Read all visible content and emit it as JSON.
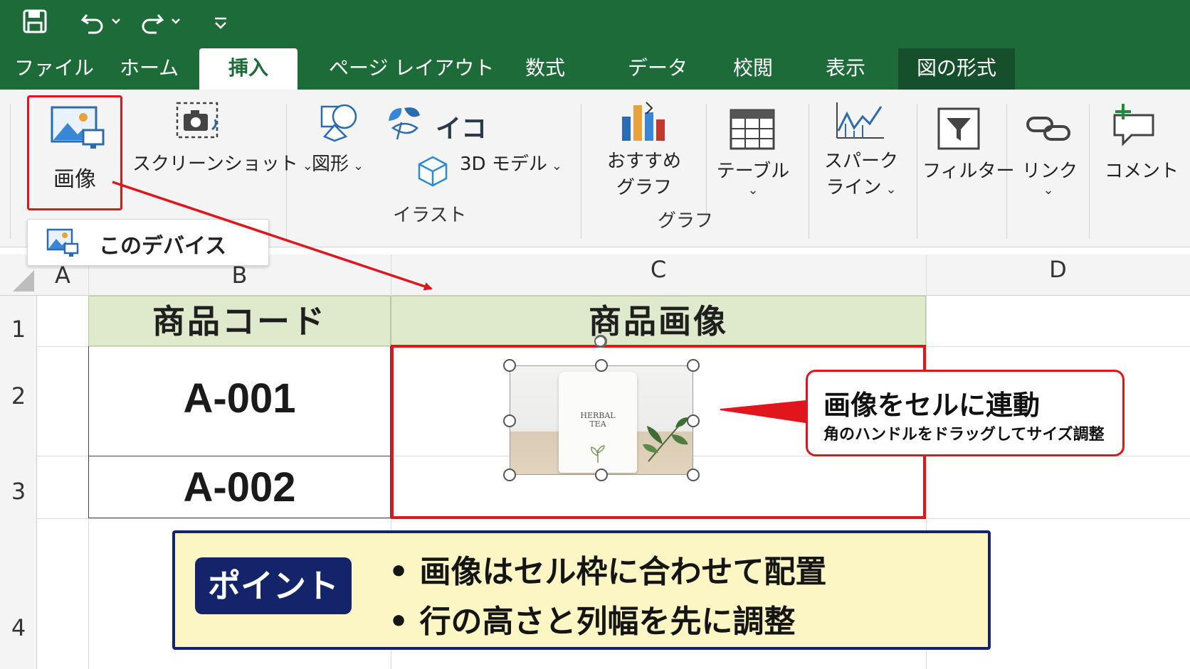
{
  "quick_access": {
    "icons": [
      "save-icon",
      "undo-icon",
      "redo-icon",
      "customize-qat-icon"
    ]
  },
  "tabs": [
    {
      "label": "ファイル"
    },
    {
      "label": "ホーム"
    },
    {
      "label": "挿入"
    },
    {
      "label": "ページ レイアウト"
    },
    {
      "label": "数式"
    },
    {
      "label": "データ"
    },
    {
      "label": "校閲"
    },
    {
      "label": "表示"
    },
    {
      "label": "図の形式"
    }
  ],
  "ribbon": {
    "picture": "画像",
    "screenshot": "スクリーンショット",
    "shapes": "図形",
    "icons": "イコ",
    "model3d": "3D モデル",
    "recommended_chart_1": "おすすめ",
    "recommended_chart_2": "グラフ",
    "table_1": "テーブル",
    "sparkline_1": "スパーク",
    "sparkline_2": "ライン",
    "filter": "フィルター",
    "link": "リンク",
    "comment": "コメント",
    "group_illust": "イラスト",
    "group_chart": "グラフ"
  },
  "dropdown": {
    "this_device": "このデバイス"
  },
  "columns": [
    "A",
    "B",
    "C",
    "D"
  ],
  "rows": [
    "1",
    "2",
    "3",
    "4"
  ],
  "cells": {
    "b1": "商品コード",
    "c1": "商品画像",
    "b2": "A-001",
    "b3": "A-002"
  },
  "product_image": {
    "line1": "HERBAL",
    "line2": "TEA"
  },
  "callout": {
    "title": "画像をセルに連動",
    "subtitle": "角のハンドルをドラッグしてサイズ調整"
  },
  "point": {
    "badge": "ポイント",
    "bullets": [
      "• 画像はセル枠に合わせて配置",
      "• 行の高さと列幅を先に調整"
    ]
  },
  "colors": {
    "title_bar": "#1e6b3a",
    "highlight_red": "#e0161c",
    "header_fill": "#dfeacd",
    "point_fill": "#fcf6c5",
    "point_border": "#13246a"
  }
}
